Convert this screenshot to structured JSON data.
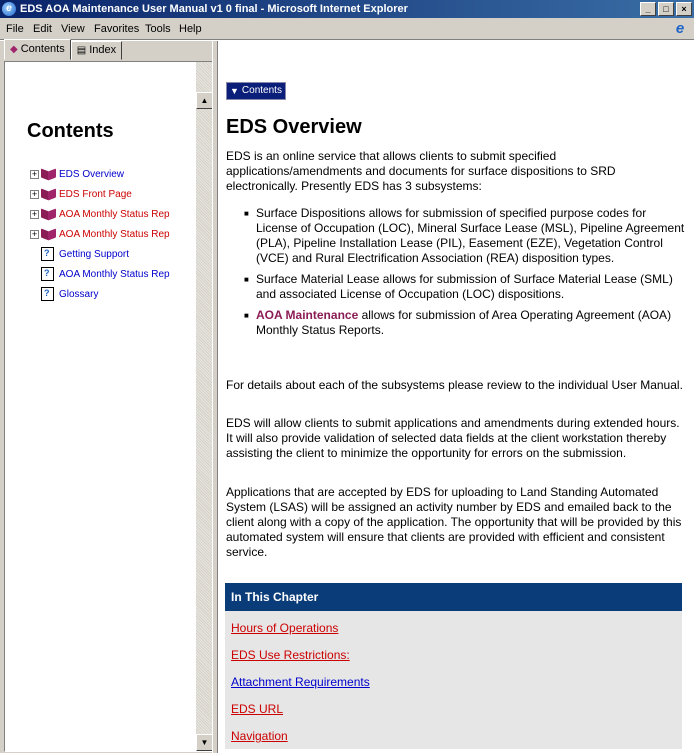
{
  "window": {
    "title": "EDS AOA Maintenance User Manual v1 0 final - Microsoft Internet Explorer",
    "min": "_",
    "max": "□",
    "close": "×"
  },
  "menu": [
    "File",
    "Edit",
    "View",
    "Favorites",
    "Tools",
    "Help"
  ],
  "tabs": {
    "contents": "Contents",
    "index": "Index"
  },
  "sidebar": {
    "heading": "Contents",
    "items": [
      {
        "label": "EDS Overview",
        "color": "#0000cc",
        "type": "book"
      },
      {
        "label": "EDS Front Page",
        "color": "#cc0000",
        "type": "book"
      },
      {
        "label": "AOA Monthly Status Rep",
        "color": "#cc0000",
        "type": "book"
      },
      {
        "label": "AOA Monthly Status Rep",
        "color": "#cc0000",
        "type": "book"
      },
      {
        "label": "Getting Support",
        "color": "#0000cc",
        "type": "page"
      },
      {
        "label": "AOA Monthly Status Rep",
        "color": "#0000cc",
        "type": "page"
      },
      {
        "label": "Glossary",
        "color": "#0000cc",
        "type": "page"
      }
    ]
  },
  "main": {
    "contents_button": "Contents",
    "title": "EDS Overview",
    "intro": "EDS is an online service that allows clients to submit specified applications/amendments and documents for surface dispositions to SRD electronically. Presently EDS has 3 subsystems:",
    "bullets": [
      "Surface Dispositions allows for submission of specified purpose codes for License of Occupation (LOC), Mineral Surface Lease (MSL), Pipeline Agreement (PLA), Pipeline Installation Lease (PIL), Easement (EZE), Vegetation Control (VCE) and Rural Electrification Association (REA) disposition types.",
      "Surface Material Lease allows for submission of Surface Material Lease (SML) and associated License of Occupation (LOC) dispositions."
    ],
    "bullet3_strong": "AOA Maintenance",
    "bullet3_rest": " allows for submission of Area Operating Agreement (AOA) Monthly Status Reports.",
    "para2": "For details about each of the subsystems please review to the individual User Manual.",
    "para3": "EDS will allow clients to submit applications and amendments during extended hours. It will also provide validation of selected data fields at the client workstation thereby assisting the client to minimize the opportunity for errors on the submission.",
    "para4": "Applications that are accepted by EDS for uploading to Land Standing Automated System (LSAS) will be assigned an activity number by EDS and emailed back to the client along with a copy of the application. The opportunity that will be provided by this automated system will ensure that clients are provided with efficient and consistent service.",
    "chapter": {
      "header": "In This Chapter",
      "links": [
        {
          "label": "Hours of Operations",
          "color": "#cc0000"
        },
        {
          "label": "EDS Use Restrictions:",
          "color": "#cc0000"
        },
        {
          "label": "Attachment Requirements",
          "color": "#0000cc"
        },
        {
          "label": "EDS URL",
          "color": "#cc0000"
        },
        {
          "label": "Navigation",
          "color": "#cc0000"
        }
      ]
    }
  }
}
